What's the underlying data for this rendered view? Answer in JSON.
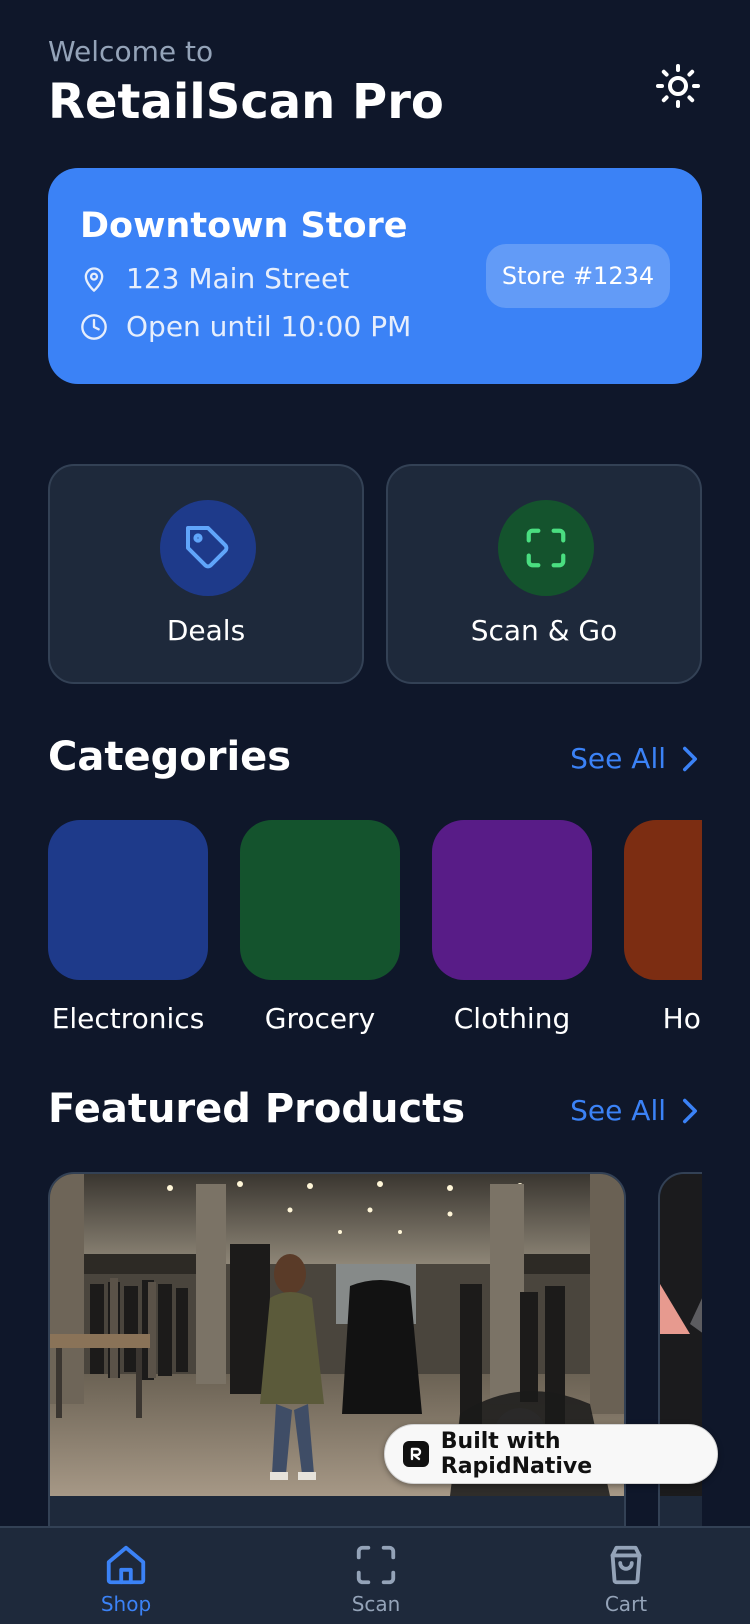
{
  "header": {
    "welcome": "Welcome to",
    "title": "RetailScan Pro",
    "theme_icon": "sun-icon"
  },
  "store": {
    "name": "Downtown Store",
    "address": "123 Main Street",
    "hours": "Open until 10:00 PM",
    "badge": "Store #1234",
    "color": "#3b82f6"
  },
  "actions": [
    {
      "label": "Deals",
      "icon": "tag-icon",
      "circle_color": "#1e3a8a",
      "icon_color": "#60a5fa"
    },
    {
      "label": "Scan & Go",
      "icon": "scan-icon",
      "circle_color": "#14532d",
      "icon_color": "#4ade80"
    }
  ],
  "categories": {
    "title": "Categories",
    "see_all": "See All",
    "items": [
      {
        "label": "Electronics",
        "color": "#1e3a8a"
      },
      {
        "label": "Grocery",
        "color": "#14532d"
      },
      {
        "label": "Clothing",
        "color": "#581c87"
      },
      {
        "label": "Home",
        "color": "#7c2d12"
      }
    ]
  },
  "featured": {
    "title": "Featured Products",
    "see_all": "See All"
  },
  "built_with": "Built with RapidNative",
  "tabs": [
    {
      "label": "Shop",
      "icon": "home-icon",
      "active": true
    },
    {
      "label": "Scan",
      "icon": "scan-icon",
      "active": false
    },
    {
      "label": "Cart",
      "icon": "shopping-bag-icon",
      "active": false
    }
  ],
  "colors": {
    "background": "#0f172a",
    "card": "#1e293b",
    "accent": "#3b82f6",
    "muted": "#94a3b8"
  }
}
